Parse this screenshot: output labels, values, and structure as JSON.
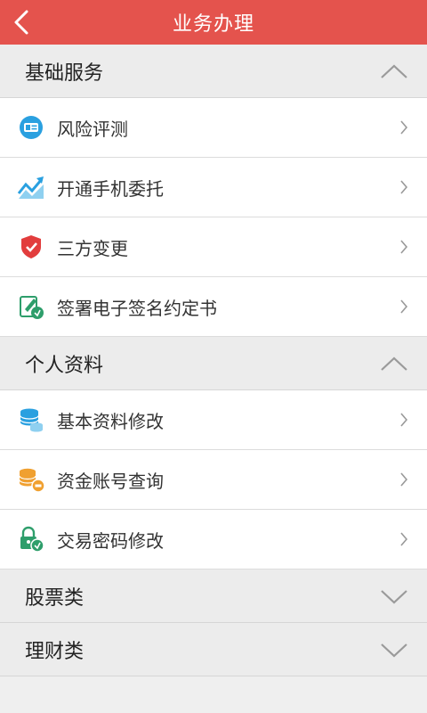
{
  "header": {
    "title": "业务办理"
  },
  "sections": [
    {
      "label": "基础服务",
      "expanded": true,
      "items": [
        {
          "label": "风险评测",
          "icon": "risk-test-icon"
        },
        {
          "label": "开通手机委托",
          "icon": "trend-chart-icon"
        },
        {
          "label": "三方变更",
          "icon": "shield-check-icon"
        },
        {
          "label": "签署电子签名约定书",
          "icon": "e-sign-icon"
        }
      ]
    },
    {
      "label": "个人资料",
      "expanded": true,
      "items": [
        {
          "label": "基本资料修改",
          "icon": "database-icon"
        },
        {
          "label": "资金账号查询",
          "icon": "coins-search-icon"
        },
        {
          "label": "交易密码修改",
          "icon": "lock-edit-icon"
        }
      ]
    },
    {
      "label": "股票类",
      "expanded": false,
      "items": []
    },
    {
      "label": "理财类",
      "expanded": false,
      "items": []
    }
  ],
  "colors": {
    "header_bg": "#e4534d",
    "icon_blue": "#2aa0e0",
    "icon_red": "#e23d3d",
    "icon_green": "#2e9e6b",
    "icon_orange": "#f0a030"
  }
}
